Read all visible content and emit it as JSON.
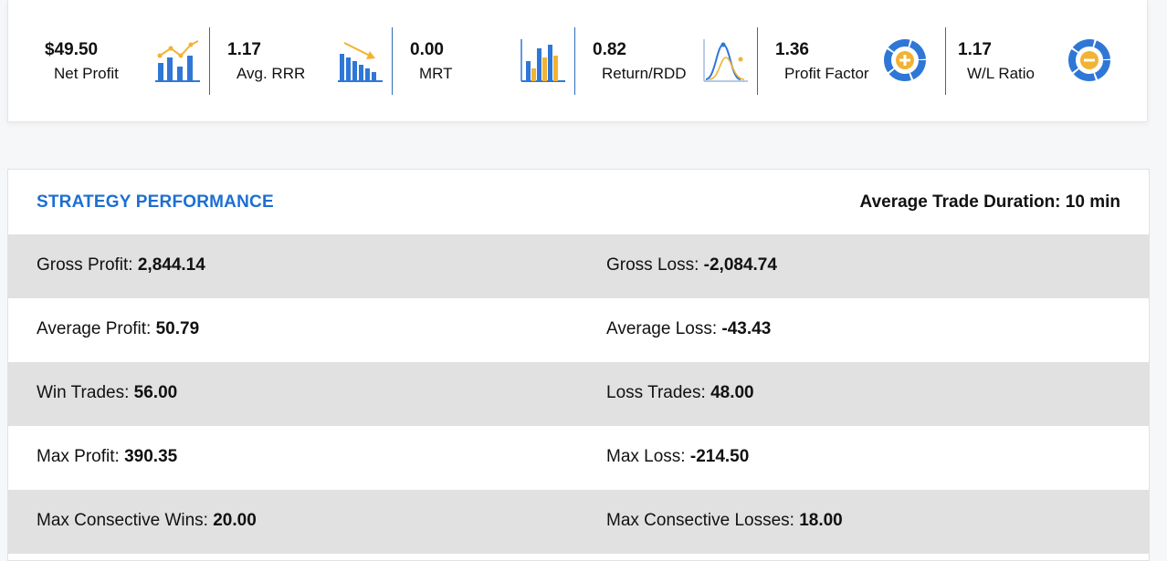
{
  "metrics": [
    {
      "value": "$49.50",
      "label": "Net Profit",
      "icon": "line-bar-chart-icon"
    },
    {
      "value": "1.17",
      "label": "Avg. RRR",
      "icon": "descending-bar-chart-icon"
    },
    {
      "value": "0.00",
      "label": "MRT",
      "icon": "grouped-bar-chart-icon"
    },
    {
      "value": "0.82",
      "label": "Return/RDD",
      "icon": "bell-curve-icon"
    },
    {
      "value": "1.36",
      "label": "Profit Factor",
      "icon": "donut-plus-icon"
    },
    {
      "value": "1.17",
      "label": "W/L Ratio",
      "icon": "donut-minus-icon"
    }
  ],
  "performance": {
    "title": "STRATEGY PERFORMANCE",
    "duration_label": "Average Trade Duration:",
    "duration_value": "10 min",
    "rows": [
      {
        "left_label": "Gross Profit:",
        "left_value": "2,844.14",
        "right_label": "Gross Loss:",
        "right_value": "-2,084.74"
      },
      {
        "left_label": "Average Profit:",
        "left_value": "50.79",
        "right_label": "Average Loss:",
        "right_value": "-43.43"
      },
      {
        "left_label": "Win Trades:",
        "left_value": "56.00",
        "right_label": "Loss Trades:",
        "right_value": "48.00"
      },
      {
        "left_label": "Max Profit:",
        "left_value": "390.35",
        "right_label": "Max Loss:",
        "right_value": "-214.50"
      },
      {
        "left_label": "Max Consective Wins:",
        "left_value": "20.00",
        "right_label": "Max Consective Losses:",
        "right_value": "18.00"
      }
    ]
  },
  "colors": {
    "accent_blue": "#1c6fd1",
    "icon_blue": "#2f77d6",
    "icon_gold": "#f2b233",
    "row_shade": "#e1e1e1"
  }
}
